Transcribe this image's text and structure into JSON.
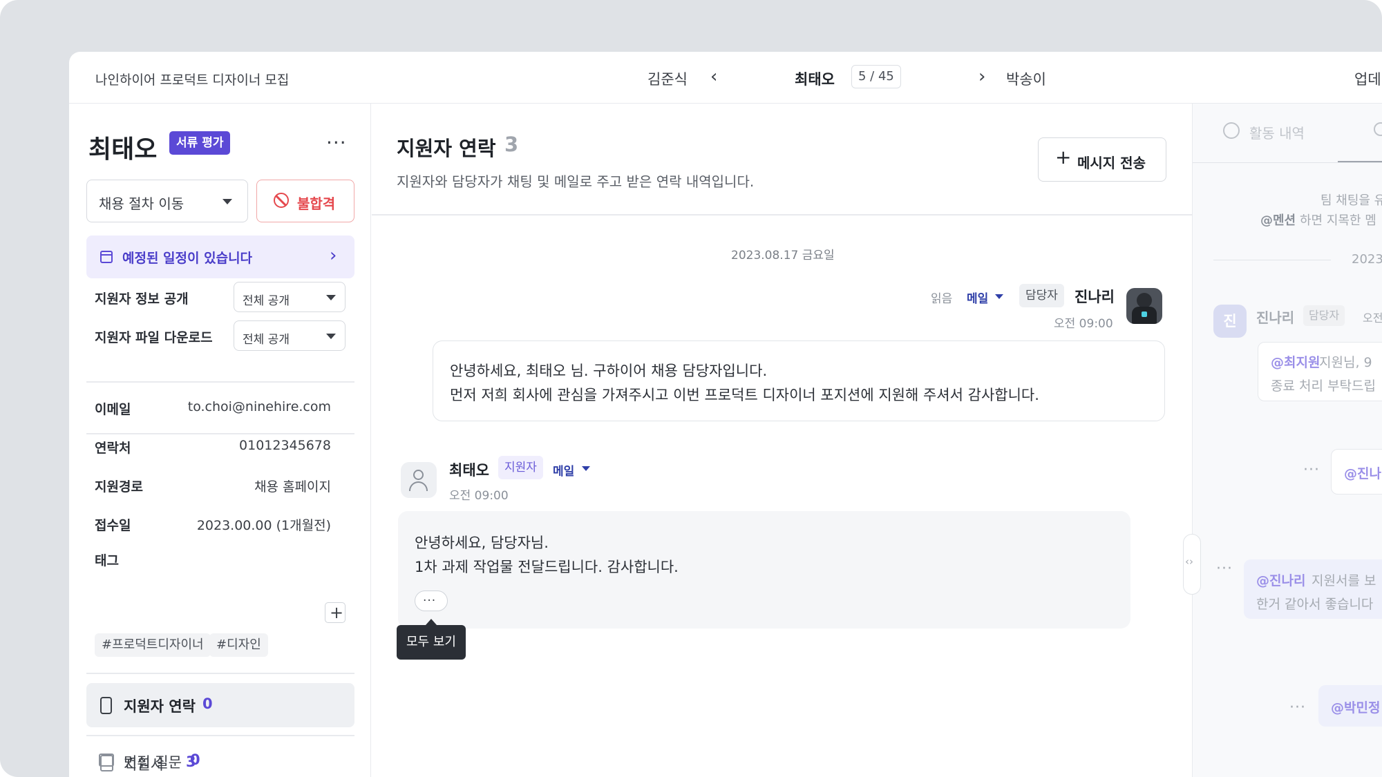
{
  "topbar": {
    "job_title": "나인하이어 프로덕트 디자이너 모집",
    "prev_applicant": "김준식",
    "current_applicant": "최태오",
    "counter": "5 / 45",
    "next_applicant": "박송이",
    "right_text": "업데"
  },
  "candidate": {
    "name": "최태오",
    "stage_badge": "서류 평가",
    "more": "···",
    "move_stage_label": "채용 절차 이동",
    "reject_label": "불합격",
    "schedule_label": "예정된 일정이 있습니다",
    "settings": [
      {
        "label": "지원자 정보 공개",
        "value": "전체 공개"
      },
      {
        "label": "지원자 파일 다운로드",
        "value": "전체 공개"
      }
    ],
    "info": [
      {
        "label": "이메일",
        "value": "to.choi@ninehire.com"
      },
      {
        "label": "연락처",
        "value": "01012345678"
      },
      {
        "label": "지원경로",
        "value": "채용 홈페이지"
      },
      {
        "label": "접수일",
        "value": "2023.00.00 (1개월전)"
      }
    ],
    "tags_label": "태그",
    "tags": [
      "#프로덕트디자이너",
      "#디자인"
    ],
    "nav": [
      {
        "label": "지원자 연락",
        "count": "0"
      },
      {
        "label": "지원서",
        "count": "3"
      },
      {
        "label": "면접 질문",
        "count": "0"
      }
    ]
  },
  "contact": {
    "title": "지원자 연락",
    "count": "3",
    "subtitle": "지원자와 담당자가 채팅 및 메일로 주고 받은 연락 내역입니다.",
    "send_button": "메시지 전송",
    "date_divider": "2023.08.17 금요일",
    "messages": [
      {
        "read": "읽음",
        "channel": "메일",
        "role": "담당자",
        "sender": "진나리",
        "time": "오전 09:00",
        "lines": [
          "안녕하세요, 최태오 님. 구하이어 채용 담당자입니다.",
          "먼저 저희 회사에 관심을 가져주시고 이번 프로덕트 디자이너 포지션에 지원해 주셔서 감사합니다."
        ]
      },
      {
        "sender": "최태오",
        "role": "지원자",
        "channel": "메일",
        "time": "오전 09:00",
        "lines": [
          "안녕하세요, 담당자님.",
          "1차 과제 작업물 전달드립니다. 감사합니다."
        ],
        "expand": "···",
        "tooltip": "모두 보기"
      }
    ]
  },
  "activity": {
    "tabs": [
      "활동 내역"
    ],
    "hint_line1": "팀 채팅을 유",
    "hint_mention": "@멘션",
    "hint_line2_rest": "하면 지목한 멤",
    "date": "2023",
    "comment": {
      "avatar": "진",
      "name": "진나리",
      "role": "담당자",
      "time": "오전",
      "mention": "@최지원",
      "text1": " 지원님, 9",
      "text2": "종료 처리 부탁드립"
    },
    "reply1_mention": "@진나",
    "reply2_mention": "@진나리",
    "reply2_text1": " 지원서를 보",
    "reply2_text2": "한거 같아서 좋습니다",
    "reply3_mention": "@박민정",
    "dots": "···",
    "handle": "‹›"
  },
  "colors": {
    "accent": "#5b49d6",
    "danger": "#e5484d",
    "mail": "#2f3fa8"
  }
}
